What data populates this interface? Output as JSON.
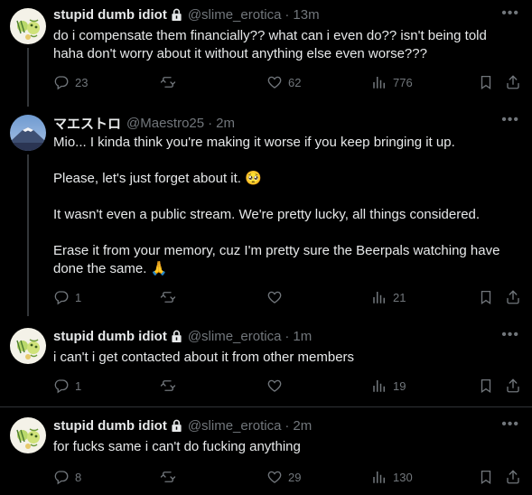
{
  "tweets": [
    {
      "name": "stupid dumb idiot",
      "handle": "@slime_erotica",
      "dot": "·",
      "time": "13m",
      "text": "do i compensate them financially?? what can i even do?? isn't being told haha don't worry about it without anything else even worse???",
      "replies": "23",
      "retweets": "",
      "likes": "62",
      "views": "776"
    },
    {
      "name": "マエストロ",
      "handle": "@Maestro25",
      "dot": "·",
      "time": "2m",
      "paragraphs": [
        "Mio... I kinda think you're making it worse if you keep bringing it up.",
        "Please, let's just forget about it. 🥺",
        "It wasn't even a public stream. We're pretty lucky, all things considered.",
        "Erase it from your memory, cuz I'm pretty sure the Beerpals watching have done the same. 🙏"
      ],
      "replies": "1",
      "retweets": "",
      "likes": "",
      "views": "21"
    },
    {
      "name": "stupid dumb idiot",
      "handle": "@slime_erotica",
      "dot": "·",
      "time": "1m",
      "text": "i can't i get contacted about it from other members",
      "replies": "1",
      "retweets": "",
      "likes": "",
      "views": "19"
    },
    {
      "name": "stupid dumb idiot",
      "handle": "@slime_erotica",
      "dot": "·",
      "time": "2m",
      "text": "for fucks same i can't do fucking anything",
      "replies": "8",
      "retweets": "",
      "likes": "29",
      "views": "130"
    }
  ],
  "icons": {
    "more": "more-horizontal-icon",
    "lock": "lock-icon",
    "reply": "reply-icon",
    "retweet": "retweet-icon",
    "like": "heart-icon",
    "views": "views-icon",
    "bookmark": "bookmark-icon",
    "share": "share-icon"
  },
  "colors": {
    "background": "#000000",
    "text": "#e7e9ea",
    "muted": "#71767b",
    "divider": "#2f3336"
  }
}
